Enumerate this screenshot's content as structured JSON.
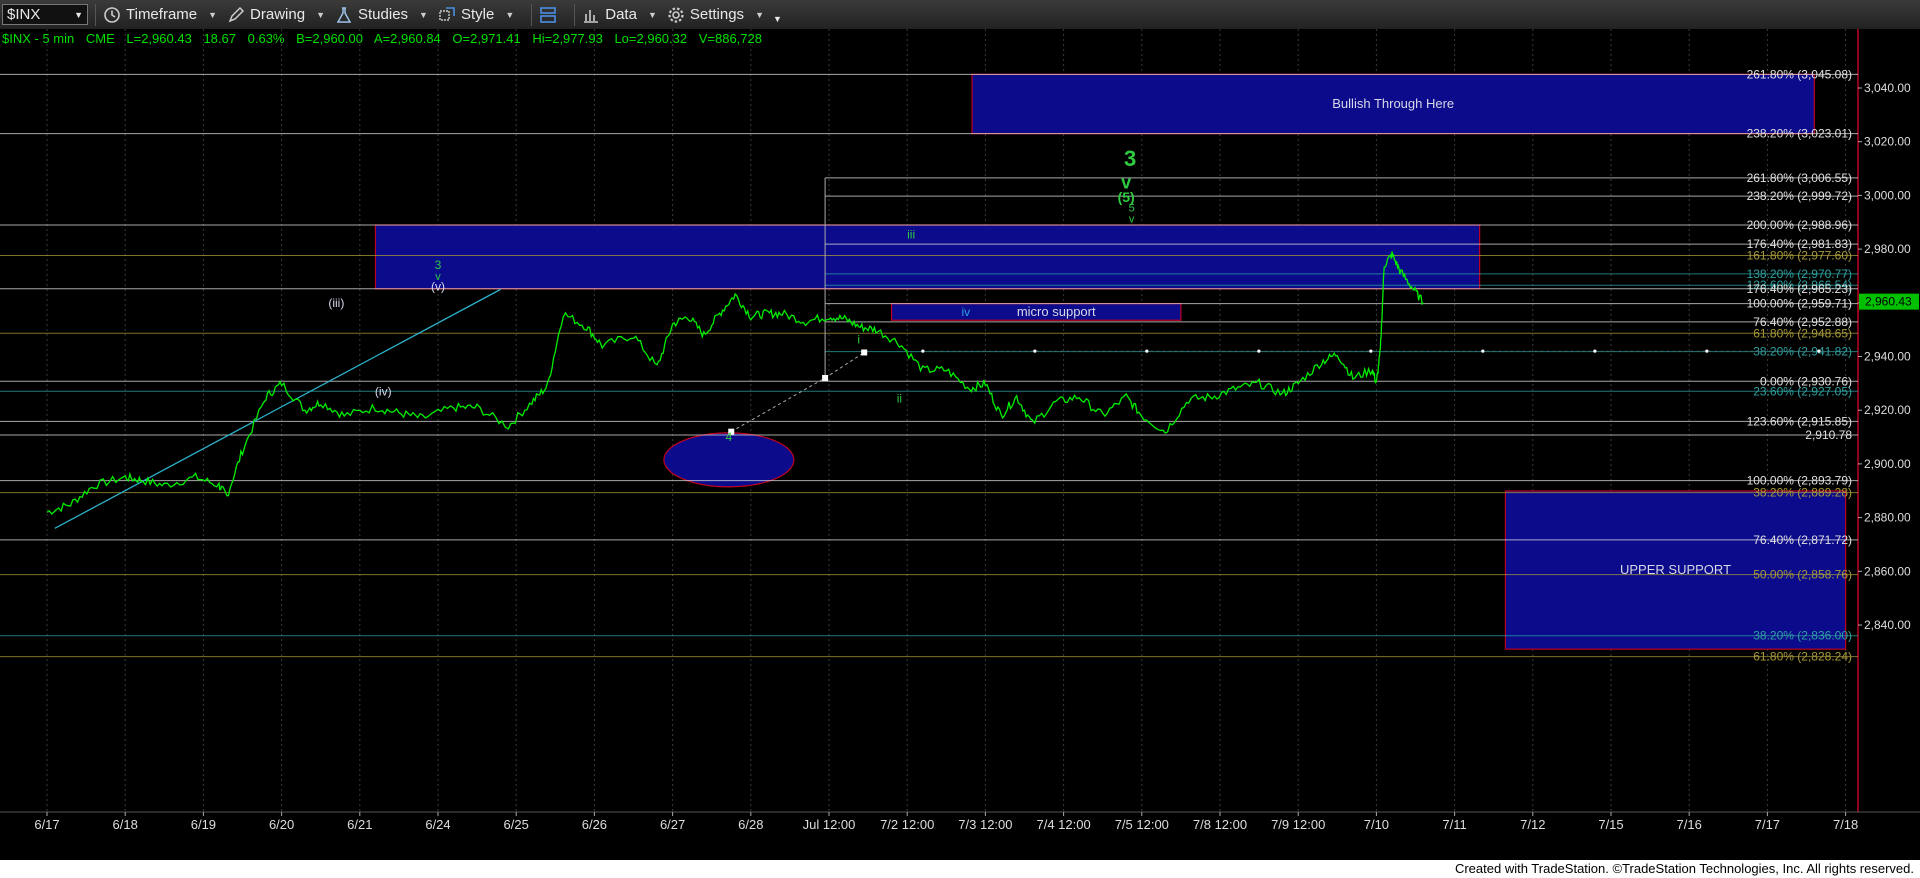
{
  "toolbar": {
    "symbol": "$INX",
    "timeframe": "Timeframe",
    "drawing": "Drawing",
    "studies": "Studies",
    "style": "Style",
    "data": "Data",
    "settings": "Settings"
  },
  "infobar": {
    "name": "$INX - 5 min",
    "exchange": "CME",
    "last": "L=2,960.43",
    "change": "18.67",
    "pct": "0.63%",
    "bid": "B=2,960.00",
    "ask": "A=2,960.84",
    "open": "O=2,971.41",
    "high": "Hi=2,977.93",
    "low": "Lo=2,960.32",
    "volume": "V=886,728"
  },
  "footer": "Created with TradeStation. ©TradeStation Technologies, Inc. All rights reserved.",
  "colors": {
    "price": "#00ee00",
    "box_fill": "#0b0b8c",
    "box_border": "#c00020",
    "text_white": "#e0e0e0",
    "fib_teal": "#2ea0a0",
    "fib_olive": "#a89a3a",
    "price_tag": "#00c000"
  },
  "chart_data": {
    "type": "line",
    "title": "",
    "ylim": [
      2818,
      3058
    ],
    "y_ticks": [
      "3,040.00",
      "3,020.00",
      "3,000.00",
      "2,980.00",
      "2,960.00",
      "2,940.00",
      "2,920.00",
      "2,900.00",
      "2,880.00",
      "2,860.00",
      "2,840.00"
    ],
    "x_ticks": [
      "6/17",
      "6/18",
      "6/19",
      "6/20",
      "6/21",
      "6/24",
      "6/25",
      "6/26",
      "6/27",
      "6/28",
      "Jul 12:00",
      "7/2 12:00",
      "7/3 12:00",
      "7/4 12:00",
      "7/5 12:00",
      "7/8 12:00",
      "7/9 12:00",
      "7/10",
      "7/11",
      "7/12",
      "7/15",
      "7/16",
      "7/17",
      "7/18"
    ],
    "last_price": "2,960.43",
    "series": [
      {
        "x": [
          0,
          0.3,
          0.6,
          1.0,
          1.2,
          1.5,
          1.9,
          2.2,
          2.3,
          2.5,
          2.8,
          3.0,
          3.3,
          3.5,
          3.8,
          4.2,
          4.5,
          4.8,
          5.2,
          5.5,
          5.9,
          6.2,
          6.4,
          6.6,
          6.9,
          7.1,
          7.5,
          7.8,
          8.0,
          8.2,
          8.4,
          8.6,
          8.8,
          9.0,
          9.2,
          9.4,
          9.7,
          10.0,
          10.2,
          10.4,
          10.6,
          10.9,
          11.2,
          11.5,
          11.8,
          12.0,
          12.2,
          12.4,
          12.6,
          12.9,
          13.2,
          13.5,
          13.8,
          14.0,
          14.3,
          14.6,
          14.9,
          15.2,
          15.5,
          15.8,
          16.0,
          16.3,
          16.5,
          16.7,
          16.95,
          17.0,
          17.05,
          17.1,
          17.2,
          17.3,
          17.45,
          17.6
        ],
        "y": [
          2882,
          2885,
          2892,
          2895,
          2894,
          2892,
          2895,
          2892,
          2888,
          2905,
          2925,
          2930,
          2920,
          2923,
          2918,
          2921,
          2919,
          2917,
          2921,
          2921,
          2914,
          2923,
          2929,
          2956,
          2951,
          2944,
          2948,
          2936,
          2952,
          2955,
          2948,
          2956,
          2963,
          2955,
          2956,
          2956,
          2953,
          2955,
          2954,
          2951,
          2950,
          2945,
          2935,
          2935,
          2928,
          2930,
          2918,
          2925,
          2915,
          2923,
          2925,
          2918,
          2925,
          2918,
          2912,
          2924,
          2925,
          2928,
          2930,
          2926,
          2930,
          2938,
          2941,
          2932,
          2935,
          2930,
          2942,
          2974,
          2978,
          2972,
          2966,
          2960
        ],
        "name": ""
      }
    ],
    "fib_levels": [
      {
        "label": "261.80% (3,045.08)",
        "value": 3045.08,
        "color": "#e0e0e0"
      },
      {
        "label": "238.20% (3,023.01)",
        "value": 3023.01,
        "color": "#e0e0e0"
      },
      {
        "label": "261.80% (3,006.55)",
        "value": 3006.55,
        "color": "#e0e0e0"
      },
      {
        "label": "238.20% (2,999.72)",
        "value": 2999.72,
        "color": "#e0e0e0"
      },
      {
        "label": "200.00% (2,988.96)",
        "value": 2988.96,
        "color": "#e0e0e0"
      },
      {
        "label": "176.40% (2,981.83)",
        "value": 2981.83,
        "color": "#e0e0e0"
      },
      {
        "label": "161.80% (2,977.60)",
        "value": 2977.6,
        "color": "#a89a3a"
      },
      {
        "label": "138.20% (2,970.77)",
        "value": 2970.77,
        "color": "#2ea0a0"
      },
      {
        "label": "123.60% (2,966.54)",
        "value": 2966.54,
        "color": "#2ea0a0"
      },
      {
        "label": "176.40% (2,965.23)",
        "value": 2965.23,
        "color": "#e0e0e0"
      },
      {
        "label": "100.00% (2,959.71)",
        "value": 2959.71,
        "color": "#e0e0e0"
      },
      {
        "label": "76.40% (2,952.88)",
        "value": 2952.88,
        "color": "#e0e0e0"
      },
      {
        "label": "61.80% (2,948.65)",
        "value": 2948.65,
        "color": "#a89a3a"
      },
      {
        "label": "38.20% (2,941.82)",
        "value": 2941.82,
        "color": "#2ea0a0"
      },
      {
        "label": "0.00% (2,930.76)",
        "value": 2930.76,
        "color": "#e0e0e0"
      },
      {
        "label": "23.60% (2,927.05)",
        "value": 2927.05,
        "color": "#2ea0a0"
      },
      {
        "label": "123.60% (2,915.85)",
        "value": 2915.85,
        "color": "#e0e0e0"
      },
      {
        "label": "2,910.78",
        "value": 2910.78,
        "color": "#e0e0e0"
      },
      {
        "label": "100.00% (2,893.79)",
        "value": 2893.79,
        "color": "#e0e0e0"
      },
      {
        "label": "38.20% (2,889.28)",
        "value": 2889.28,
        "color": "#a89a3a"
      },
      {
        "label": "76.40% (2,871.72)",
        "value": 2871.72,
        "color": "#e0e0e0"
      },
      {
        "label": "50.00% (2,858.76)",
        "value": 2858.76,
        "color": "#a89a3a"
      },
      {
        "label": "38.20% (2,836.00)",
        "value": 2836.0,
        "color": "#2ea0a0"
      },
      {
        "label": "61.80% (2,828.24)",
        "value": 2828.24,
        "color": "#a89a3a"
      }
    ],
    "zones": [
      {
        "label": "Bullish Through Here",
        "x0": 11.83,
        "x1": 22.6,
        "y0": 3023.01,
        "y1": 3045.08
      },
      {
        "label": "",
        "x0": 4.2,
        "x1": 18.32,
        "y0": 2965.23,
        "y1": 2988.96
      },
      {
        "label": "micro support",
        "x0": 10.8,
        "x1": 14.5,
        "y0": 2953.5,
        "y1": 2959.7
      },
      {
        "label": "UPPER SUPPORT",
        "x0": 18.65,
        "x1": 23.0,
        "y0": 2831.0,
        "y1": 2889.9
      }
    ],
    "wave_labels": [
      {
        "text": "3",
        "x": 13.85,
        "y": 3011,
        "size": 22,
        "bold": true
      },
      {
        "text": "v",
        "x": 13.8,
        "y": 3002.5,
        "size": 18,
        "bold": true
      },
      {
        "text": "(5)",
        "x": 13.8,
        "y": 2997.5,
        "size": 14,
        "bold": true
      },
      {
        "text": "5",
        "x": 13.87,
        "y": 2994,
        "size": 11,
        "bold": false
      },
      {
        "text": "v",
        "x": 13.87,
        "y": 2990,
        "size": 11,
        "bold": false
      },
      {
        "text": "iii",
        "x": 11.05,
        "y": 2984.0,
        "size": 12,
        "bold": false
      },
      {
        "text": "3",
        "x": 5.0,
        "y": 2972.6,
        "size": 12,
        "bold": false
      },
      {
        "text": "v",
        "x": 5.0,
        "y": 2968.5,
        "size": 11,
        "bold": false
      },
      {
        "text": "(v)",
        "x": 5.0,
        "y": 2964.5,
        "size": 12,
        "bold": false
      },
      {
        "text": "(iii)",
        "x": 3.7,
        "y": 2958.5,
        "size": 12,
        "bold": false
      },
      {
        "text": "(iv)",
        "x": 4.3,
        "y": 2925.5,
        "size": 12,
        "bold": false
      },
      {
        "text": "iv",
        "x": 11.75,
        "y": 2955.0,
        "size": 12,
        "bold": false
      },
      {
        "text": "i",
        "x": 10.38,
        "y": 2944.8,
        "size": 12,
        "bold": false
      },
      {
        "text": "ii",
        "x": 10.9,
        "y": 2922.8,
        "size": 12,
        "bold": false
      },
      {
        "text": "4",
        "x": 8.72,
        "y": 2908.5,
        "size": 12,
        "bold": false
      }
    ]
  }
}
